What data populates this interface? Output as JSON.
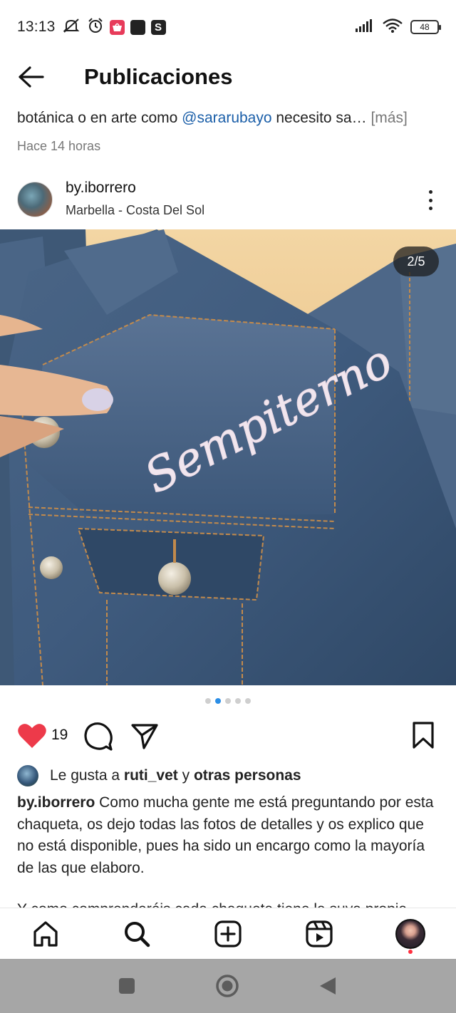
{
  "status_bar": {
    "time": "13:13",
    "app_badge": "S",
    "battery": "48",
    "icons": [
      "mute-icon",
      "alarm-icon",
      "shop-icon",
      "app-icon",
      "s-app-icon",
      "signal-icon",
      "wifi-icon",
      "battery-icon"
    ]
  },
  "header": {
    "title": "Publicaciones",
    "back_icon": "arrow-left-icon"
  },
  "previous_post": {
    "caption_start": "botánica o en arte como ",
    "mention": "@sararubayo",
    "caption_end": " necesito sa… ",
    "more": "[más]",
    "time_ago": "Hace 14 horas"
  },
  "post": {
    "username": "by.iborrero",
    "location": "Marbella - Costa Del Sol",
    "image_counter": "2/5",
    "image_embroidery_text": "Sempiterno",
    "carousel_total": 5,
    "carousel_active": 2,
    "like_count": "19",
    "liked_by_prefix": "Le gusta a ",
    "liked_by_user": "ruti_vet",
    "liked_by_join": " y ",
    "liked_by_others": "otras personas",
    "caption_user": "by.iborrero",
    "caption_text": " Como mucha gente me está preguntando por esta chaqueta, os dejo todas las fotos de detalles y os explico que no está disponible, pues ha sido un encargo como la mayoría de las que elaboro.",
    "caption_cut": "Y como comprenderéis cada chaqueta tiene la suya propia"
  },
  "colors": {
    "like_red": "#ed3a4a",
    "mention_blue": "#1a5ea8",
    "dot_active": "#2b8ee6"
  }
}
